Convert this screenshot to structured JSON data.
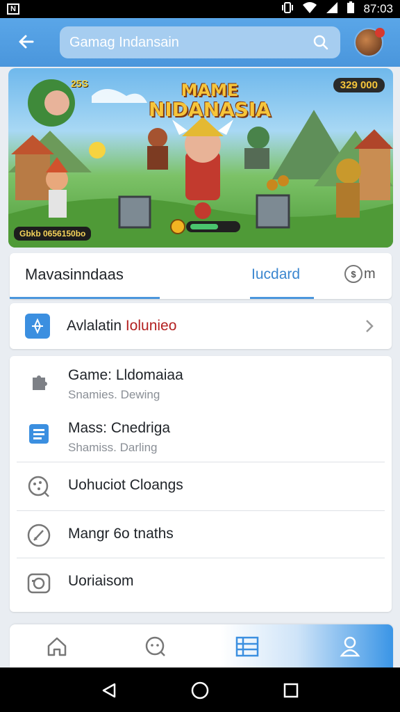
{
  "status_bar": {
    "time": "87:03",
    "left_icon": "notification-icon",
    "icons": [
      "vibrate-icon",
      "wifi-icon",
      "signal-icon",
      "battery-icon"
    ]
  },
  "top_bar": {
    "search_text": "Gamag Indansain",
    "back_icon": "back-arrow-icon",
    "search_icon": "search-icon",
    "avatar": "avatar",
    "accent": "#4a96dc"
  },
  "banner": {
    "title_line1": "MAME",
    "title_line2": "NIDANASIA",
    "coins": "25S",
    "score": "329 000",
    "tag": "Gbkb 0656150bo"
  },
  "tabs": {
    "main": "Mavasinndaas",
    "secondary": "Iucdard",
    "icon_suffix": "m",
    "icon_glyph": "$"
  },
  "featured": {
    "label_dark": "Avlalatin ",
    "label_red": "Iolunieo",
    "icon": "compass-icon"
  },
  "list": [
    {
      "title": "Game: Lldomaiaa",
      "subtitle": "Snamies. Dewing",
      "icon": "puzzle-icon"
    },
    {
      "title": "Mass: Cnedriga",
      "subtitle": "Shamiss. Darling",
      "icon": "document-icon"
    },
    {
      "title": "Uohuciot Cloangs",
      "subtitle": "",
      "icon": "chat-bubble-icon"
    },
    {
      "title": "Mangr 6o tnaths",
      "subtitle": "",
      "icon": "pen-icon"
    },
    {
      "title": "Uoriaisom",
      "subtitle": "",
      "icon": "camera-icon"
    }
  ],
  "bottom_nav": [
    "home-icon",
    "chat-icon",
    "list-icon",
    "profile-icon"
  ],
  "system_nav": [
    "back-triangle-icon",
    "home-circle-icon",
    "recents-square-icon"
  ]
}
